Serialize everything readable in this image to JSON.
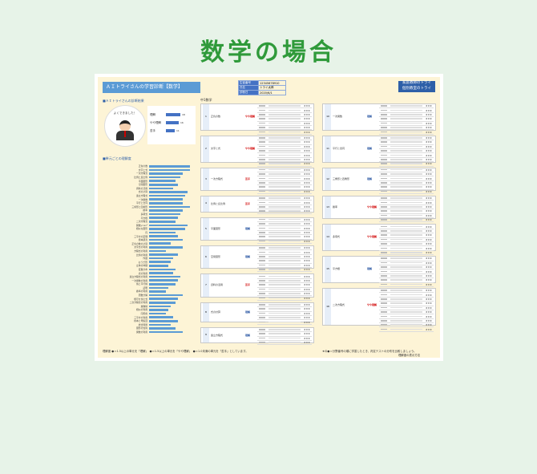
{
  "page_title": "数学の場合",
  "sheet": {
    "header": "ＡＩトライさんの学習診断【数学】",
    "info": [
      {
        "k": "生徒番号",
        "v": "12345678910"
      },
      {
        "k": "氏名",
        "v": "トライ太郎"
      },
      {
        "k": "診断日",
        "v": "2020/6/1"
      }
    ],
    "brand_line1": "家庭教師のトライ",
    "brand_line2": "個別教室のトライ",
    "section_results": "■ＡＩトライさんの診断結果",
    "greeting": "よくできました！",
    "scores": [
      {
        "label": "理解",
        "value": "18",
        "ratio": 0.9
      },
      {
        "label": "やや理解",
        "value": "16",
        "ratio": 0.8
      },
      {
        "label": "苦手",
        "value": "11",
        "ratio": 0.55
      }
    ],
    "section_units": "■単元ごとの理解度",
    "unit_bars": [
      {
        "label": "正負の数",
        "value": 0.85
      },
      {
        "label": "文字と式",
        "value": 0.85
      },
      {
        "label": "一次方程式",
        "value": 0.7
      },
      {
        "label": "比例と反比例",
        "value": 0.65
      },
      {
        "label": "平面図形",
        "value": 0.55
      },
      {
        "label": "空間図形",
        "value": 0.6
      },
      {
        "label": "資料の活用",
        "value": 0.5
      },
      {
        "label": "式の計算",
        "value": 0.8
      },
      {
        "label": "連立方程式",
        "value": 0.75
      },
      {
        "label": "一次関数",
        "value": 0.7
      },
      {
        "label": "平行と合同",
        "value": 0.7
      },
      {
        "label": "三角形と四角形",
        "value": 0.85
      },
      {
        "label": "確率",
        "value": 0.7
      },
      {
        "label": "多項式",
        "value": 0.65
      },
      {
        "label": "平方根",
        "value": 0.6
      },
      {
        "label": "二次方程式",
        "value": 0.55
      },
      {
        "label": "関数y=ax²",
        "value": 0.8
      },
      {
        "label": "相似な図形",
        "value": 0.75
      },
      {
        "label": "円",
        "value": 0.55
      },
      {
        "label": "三平方の定理",
        "value": 0.6
      },
      {
        "label": "標本調査",
        "value": 0.7
      },
      {
        "label": "正負の数の計算",
        "value": 0.45
      },
      {
        "label": "文字式の利用",
        "value": 0.7
      },
      {
        "label": "方程式の利用",
        "value": 0.35
      },
      {
        "label": "比例の利用",
        "value": 0.6
      },
      {
        "label": "作図",
        "value": 0.5
      },
      {
        "label": "おうぎ形",
        "value": 0.45
      },
      {
        "label": "立体の体積",
        "value": 0.4
      },
      {
        "label": "度数分布",
        "value": 0.55
      },
      {
        "label": "式の利用",
        "value": 0.5
      },
      {
        "label": "連立方程式の利用",
        "value": 0.65
      },
      {
        "label": "一次関数の利用",
        "value": 0.6
      },
      {
        "label": "角と平行線",
        "value": 0.55
      },
      {
        "label": "証明",
        "value": 0.4
      },
      {
        "label": "確率の利用",
        "value": 0.35
      },
      {
        "label": "因数分解",
        "value": 0.7
      },
      {
        "label": "根号を含む式",
        "value": 0.6
      },
      {
        "label": "二次方程式の利用",
        "value": 0.55
      },
      {
        "label": "放物線",
        "value": 0.45
      },
      {
        "label": "相似の利用",
        "value": 0.4
      },
      {
        "label": "円周角",
        "value": 0.35
      },
      {
        "label": "三平方の利用",
        "value": 0.5
      },
      {
        "label": "標本と母集団",
        "value": 0.6
      },
      {
        "label": "総合問題",
        "value": 0.45
      },
      {
        "label": "図形の性質",
        "value": 0.55
      },
      {
        "label": "関数の利用",
        "value": 0.7
      }
    ],
    "col1_head": "中1数学",
    "col1_units": [
      {
        "no": "1",
        "name": "正負の数",
        "eval": "やや理解",
        "color": "#d00000",
        "rows": 7
      },
      {
        "no": "2",
        "name": "文字と式",
        "eval": "やや理解",
        "color": "#d00000",
        "rows": 7
      },
      {
        "no": "3",
        "name": "一次方程式",
        "eval": "苦手",
        "color": "#d00000",
        "rows": 6
      },
      {
        "no": "4",
        "name": "比例と反比例",
        "eval": "苦手",
        "color": "#d00000",
        "rows": 4
      },
      {
        "no": "5",
        "name": "平面図形",
        "eval": "理解",
        "color": "#1f4e9e",
        "rows": 6
      },
      {
        "no": "6",
        "name": "空間図形",
        "eval": "理解",
        "color": "#1f4e9e",
        "rows": 6
      },
      {
        "no": "7",
        "name": "資料の活用",
        "eval": "苦手",
        "color": "#d00000",
        "rows": 6
      },
      {
        "no": "8",
        "name": "式の計算",
        "eval": "理解",
        "color": "#1f4e9e",
        "rows": 5
      },
      {
        "no": "9",
        "name": "連立方程式",
        "eval": "理解",
        "color": "#1f4e9e",
        "rows": 4
      }
    ],
    "col2_units": [
      {
        "no": "10",
        "name": "一次関数",
        "eval": "理解",
        "color": "#1f4e9e",
        "rows": 7
      },
      {
        "no": "11",
        "name": "平行と合同",
        "eval": "理解",
        "color": "#1f4e9e",
        "rows": 7
      },
      {
        "no": "12",
        "name": "三角形と四角形",
        "eval": "理解",
        "color": "#1f4e9e",
        "rows": 6
      },
      {
        "no": "13",
        "name": "確率",
        "eval": "やや理解",
        "color": "#d00000",
        "rows": 6
      },
      {
        "no": "14",
        "name": "多項式",
        "eval": "やや理解",
        "color": "#d00000",
        "rows": 7
      },
      {
        "no": "15",
        "name": "平方根",
        "eval": "理解",
        "color": "#1f4e9e",
        "rows": 7
      },
      {
        "no": "16",
        "name": "二次方程式",
        "eval": "やや理解",
        "color": "#d00000",
        "rows": 10
      }
    ],
    "stars": "★★★",
    "footer_left": "理解度 ●＝1.5以上の単元を「理解」　●＝1.5以上の単元を「やや理解」　●＝1.0未満の単元を「苦手」としています。",
    "footer_right": "★の●＝分野番号の順に学習したとき、判定テストの分布を比較しましょう。",
    "footer_page": "理解度の表示方法"
  }
}
